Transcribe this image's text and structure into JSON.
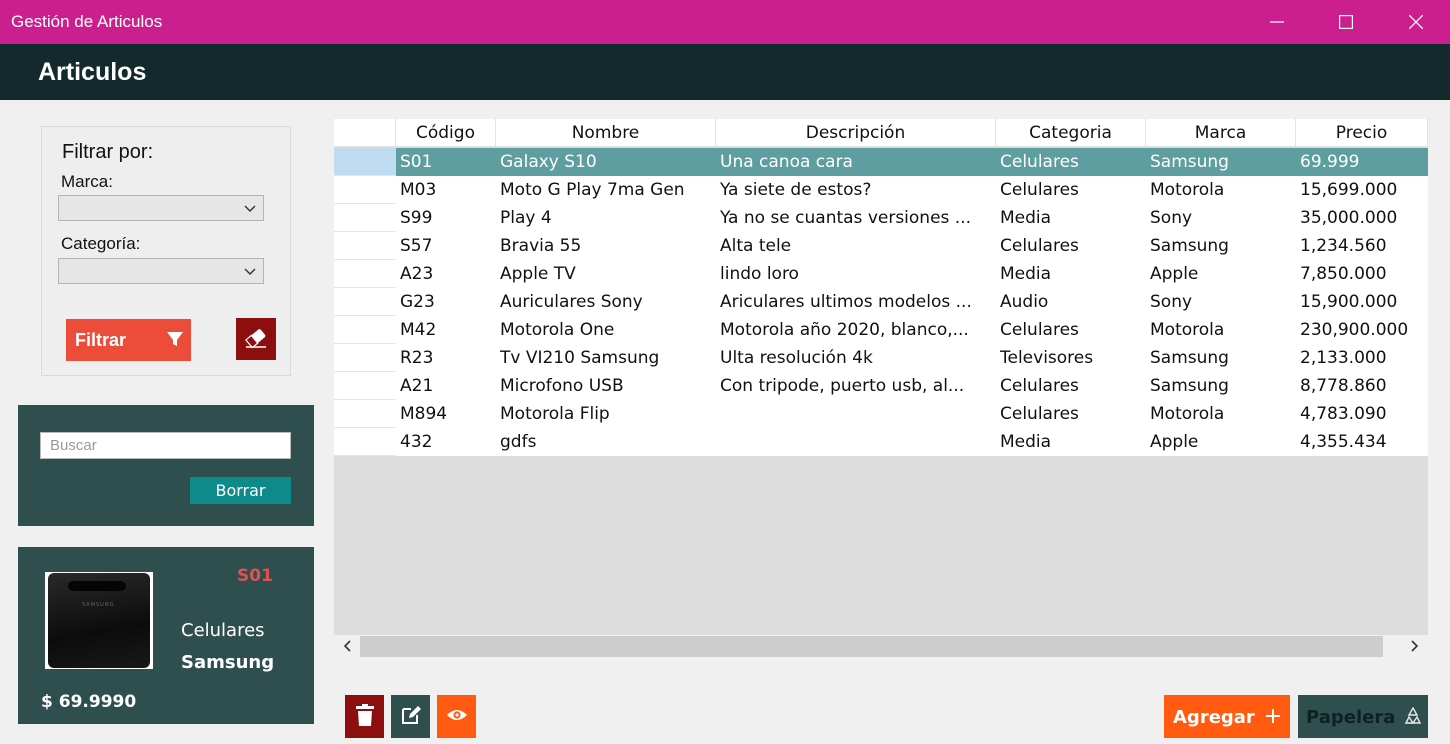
{
  "window": {
    "title": "Gestión de Articulos"
  },
  "header": {
    "title": "Articulos"
  },
  "filter": {
    "title": "Filtrar por:",
    "marca_label": "Marca:",
    "marca_value": "",
    "categoria_label": "Categoría:",
    "categoria_value": "",
    "filter_button": "Filtrar"
  },
  "search": {
    "placeholder": "Buscar",
    "value": "",
    "clear_button": "Borrar"
  },
  "detail": {
    "code": "S01",
    "category": "Celulares",
    "brand": "Samsung",
    "price": "$ 69.9990"
  },
  "table": {
    "columns": [
      "Código",
      "Nombre",
      "Descripción",
      "Categoria",
      "Marca",
      "Precio"
    ],
    "rows": [
      [
        "S01",
        "Galaxy S10",
        "Una canoa cara",
        "Celulares",
        "Samsung",
        "69.999"
      ],
      [
        "M03",
        "Moto G Play 7ma Gen",
        "Ya siete de estos?",
        "Celulares",
        "Motorola",
        "15,699.000"
      ],
      [
        "S99",
        "Play 4",
        "Ya no se cuantas versiones ...",
        "Media",
        "Sony",
        "35,000.000"
      ],
      [
        "S57",
        "Bravia 55",
        "Alta tele",
        "Celulares",
        "Samsung",
        "1,234.560"
      ],
      [
        "A23",
        "Apple TV",
        "lindo loro",
        "Media",
        "Apple",
        "7,850.000"
      ],
      [
        "G23",
        "Auriculares Sony",
        "Ariculares ultimos modelos ...",
        "Audio",
        "Sony",
        "15,900.000"
      ],
      [
        "M42",
        "Motorola One",
        "Motorola año 2020, blanco,...",
        "Celulares",
        "Motorola",
        "230,900.000"
      ],
      [
        "R23",
        "Tv VI210 Samsung",
        "Ulta resolución 4k",
        "Televisores",
        "Samsung",
        "2,133.000"
      ],
      [
        "A21",
        "Microfono USB",
        "Con tripode, puerto usb, al...",
        "Celulares",
        "Samsung",
        "8,778.860"
      ],
      [
        "M894",
        "Motorola Flip",
        "",
        "Celulares",
        "Motorola",
        "4,783.090"
      ],
      [
        "432",
        "gdfs",
        "",
        "Media",
        "Apple",
        "4,355.434"
      ]
    ],
    "selected_row": 0
  },
  "actions": {
    "add_label": "Agregar",
    "trash_label": "Papelera"
  },
  "colors": {
    "titlebar": "#cc1f8f",
    "header": "#14292b",
    "panel": "#2f4f4f",
    "selected_row": "#5f9ea0",
    "accent_orange": "#ff5a10",
    "filter_button": "#ec4d3a",
    "dark_red": "#8c0e0e"
  },
  "icons": {
    "filter_button": "funnel-icon",
    "clear_filter": "eraser-icon",
    "delete": "trash-icon",
    "edit": "edit-icon",
    "view": "eye-icon",
    "add": "plus-icon",
    "trash_bin": "recycle-icon"
  }
}
